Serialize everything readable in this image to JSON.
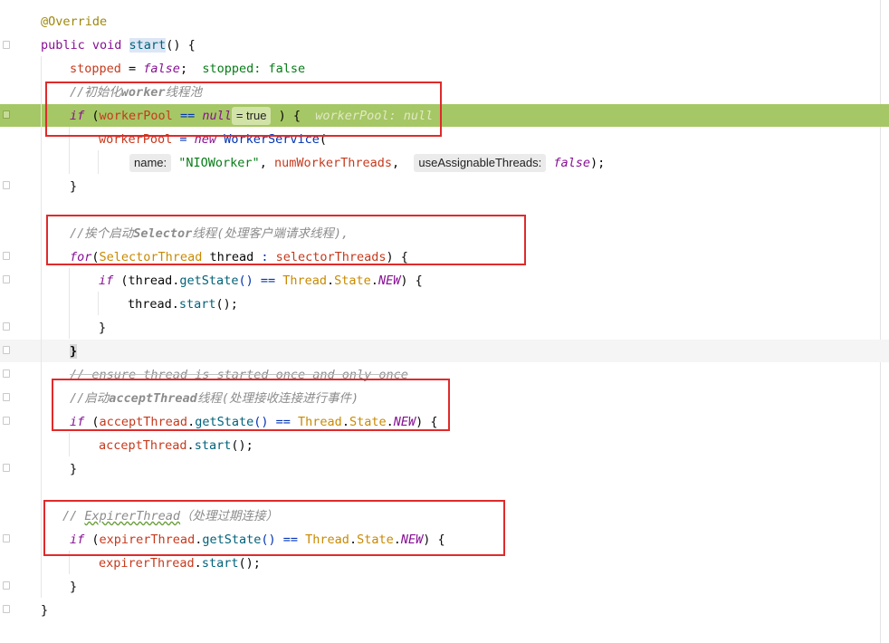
{
  "editor": {
    "lines": [
      {
        "id": "l1",
        "text": "@Override"
      },
      {
        "id": "l2a",
        "text": "public void "
      },
      {
        "id": "l2b",
        "text": "start"
      },
      {
        "id": "l2c",
        "text": "() {"
      },
      {
        "id": "l3a",
        "text": "stopped"
      },
      {
        "id": "l3b",
        "text": " = "
      },
      {
        "id": "l3c",
        "text": "false"
      },
      {
        "id": "l3d",
        "text": ";"
      },
      {
        "id": "l3e",
        "text": "stopped: false"
      },
      {
        "id": "l4a",
        "text": "//初始化"
      },
      {
        "id": "l4b",
        "text": "worker"
      },
      {
        "id": "l4c",
        "text": "线程池"
      },
      {
        "id": "l5a",
        "text": "if"
      },
      {
        "id": "l5b",
        "text": " ("
      },
      {
        "id": "l5c",
        "text": "workerPool"
      },
      {
        "id": "l5d",
        "text": " == "
      },
      {
        "id": "l5e",
        "text": "null"
      },
      {
        "id": "l5hint",
        "text": "= true"
      },
      {
        "id": "l5f",
        "text": " ) {  "
      },
      {
        "id": "l5g",
        "text": "workerPool: null"
      },
      {
        "id": "l6a",
        "text": "workerPool"
      },
      {
        "id": "l6b",
        "text": " = "
      },
      {
        "id": "l6c",
        "text": "new "
      },
      {
        "id": "l6d",
        "text": "WorkerService"
      },
      {
        "id": "l6e",
        "text": "("
      },
      {
        "id": "l7hint1",
        "text": "name:"
      },
      {
        "id": "l7a",
        "text": "\"NIOWorker\""
      },
      {
        "id": "l7b",
        "text": ", "
      },
      {
        "id": "l7c",
        "text": "numWorkerThreads"
      },
      {
        "id": "l7d",
        "text": ",  "
      },
      {
        "id": "l7hint2",
        "text": "useAssignableThreads:"
      },
      {
        "id": "l7e",
        "text": "false"
      },
      {
        "id": "l7f",
        "text": ");"
      },
      {
        "id": "l8",
        "text": "}"
      },
      {
        "id": "l9a",
        "text": "//挨个启动"
      },
      {
        "id": "l9b",
        "text": "Selector"
      },
      {
        "id": "l9c",
        "text": "线程(处理客户端请求线程),"
      },
      {
        "id": "l10a",
        "text": "for"
      },
      {
        "id": "l10b",
        "text": "("
      },
      {
        "id": "l10c",
        "text": "SelectorThread"
      },
      {
        "id": "l10d",
        "text": " thread"
      },
      {
        "id": "l10e",
        "text": " : "
      },
      {
        "id": "l10f",
        "text": "selectorThreads"
      },
      {
        "id": "l10g",
        "text": ") {"
      },
      {
        "id": "l11a",
        "text": "if"
      },
      {
        "id": "l11b",
        "text": " (thread."
      },
      {
        "id": "l11c",
        "text": "getState"
      },
      {
        "id": "l11d",
        "text": "() == "
      },
      {
        "id": "l11e",
        "text": "Thread"
      },
      {
        "id": "l11f",
        "text": "."
      },
      {
        "id": "l11g",
        "text": "State"
      },
      {
        "id": "l11h",
        "text": "."
      },
      {
        "id": "l11i",
        "text": "NEW"
      },
      {
        "id": "l11j",
        "text": ") {"
      },
      {
        "id": "l12a",
        "text": "thread."
      },
      {
        "id": "l12b",
        "text": "start"
      },
      {
        "id": "l12c",
        "text": "();"
      },
      {
        "id": "l13",
        "text": "}"
      },
      {
        "id": "l14",
        "text": "}"
      },
      {
        "id": "l15",
        "text": "// ensure thread is started once and only once"
      },
      {
        "id": "l16a",
        "text": "//启动"
      },
      {
        "id": "l16b",
        "text": "acceptThread"
      },
      {
        "id": "l16c",
        "text": "线程(处理接收连接进行事件)"
      },
      {
        "id": "l17a",
        "text": "if"
      },
      {
        "id": "l17b",
        "text": " ("
      },
      {
        "id": "l17c",
        "text": "acceptThread"
      },
      {
        "id": "l17d",
        "text": "."
      },
      {
        "id": "l17e",
        "text": "getState"
      },
      {
        "id": "l17f",
        "text": "() == "
      },
      {
        "id": "l17g",
        "text": "Thread"
      },
      {
        "id": "l17h",
        "text": "."
      },
      {
        "id": "l17i",
        "text": "State"
      },
      {
        "id": "l17j",
        "text": "."
      },
      {
        "id": "l17k",
        "text": "NEW"
      },
      {
        "id": "l17l",
        "text": ") {"
      },
      {
        "id": "l18a",
        "text": "acceptThread"
      },
      {
        "id": "l18b",
        "text": "."
      },
      {
        "id": "l18c",
        "text": "start"
      },
      {
        "id": "l18d",
        "text": "();"
      },
      {
        "id": "l19",
        "text": "}"
      },
      {
        "id": "l20a",
        "text": "// "
      },
      {
        "id": "l20b",
        "text": "ExpirerThread"
      },
      {
        "id": "l20c",
        "text": "（处理过期连接）"
      },
      {
        "id": "l21a",
        "text": "if"
      },
      {
        "id": "l21b",
        "text": " ("
      },
      {
        "id": "l21c",
        "text": "expirerThread"
      },
      {
        "id": "l21d",
        "text": "."
      },
      {
        "id": "l21e",
        "text": "getState"
      },
      {
        "id": "l21f",
        "text": "() == "
      },
      {
        "id": "l21g",
        "text": "Thread"
      },
      {
        "id": "l21h",
        "text": "."
      },
      {
        "id": "l21i",
        "text": "State"
      },
      {
        "id": "l21j",
        "text": "."
      },
      {
        "id": "l21k",
        "text": "NEW"
      },
      {
        "id": "l21l",
        "text": ") {"
      },
      {
        "id": "l22a",
        "text": "expirerThread"
      },
      {
        "id": "l22b",
        "text": "."
      },
      {
        "id": "l22c",
        "text": "start"
      },
      {
        "id": "l22d",
        "text": "();"
      },
      {
        "id": "l23",
        "text": "}"
      },
      {
        "id": "l24",
        "text": "}"
      }
    ]
  },
  "colors": {
    "execution_line": "#a6c765",
    "annotation_box": "#e02a2a",
    "keyword": "#0033b3",
    "field": "#871094",
    "string": "#067d17",
    "comment": "#8c8c8c"
  },
  "icons": [
    "fold-marker-icon"
  ]
}
